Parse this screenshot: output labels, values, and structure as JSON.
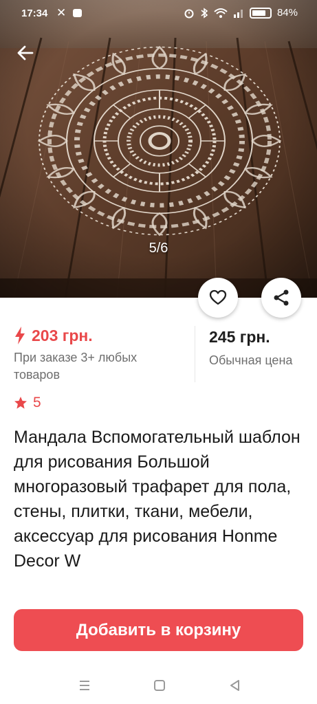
{
  "status_bar": {
    "time": "17:34",
    "battery": "84%"
  },
  "gallery": {
    "counter": "5/6"
  },
  "price": {
    "promo_price": "203 грн.",
    "promo_note": "При заказе 3+ любых товаров",
    "regular_price": "245 грн.",
    "regular_note": "Обычная цена"
  },
  "rating": {
    "value": "5"
  },
  "product": {
    "title": "Мандала Вспомогательный шаблон для рисования Большой многоразовый трафарет для пола, стены, плитки, ткани, мебели, аксессуар для рисования Honme Decor W"
  },
  "actions": {
    "add_to_cart": "Добавить в корзину"
  },
  "colors": {
    "accent": "#ee4d52",
    "price_red": "#e9484a",
    "wood": "#5a3b28"
  },
  "icons": [
    "back-arrow-icon",
    "heart-icon",
    "share-icon",
    "lightning-icon",
    "star-icon",
    "menu-icon",
    "home-icon",
    "back-triangle-icon"
  ]
}
